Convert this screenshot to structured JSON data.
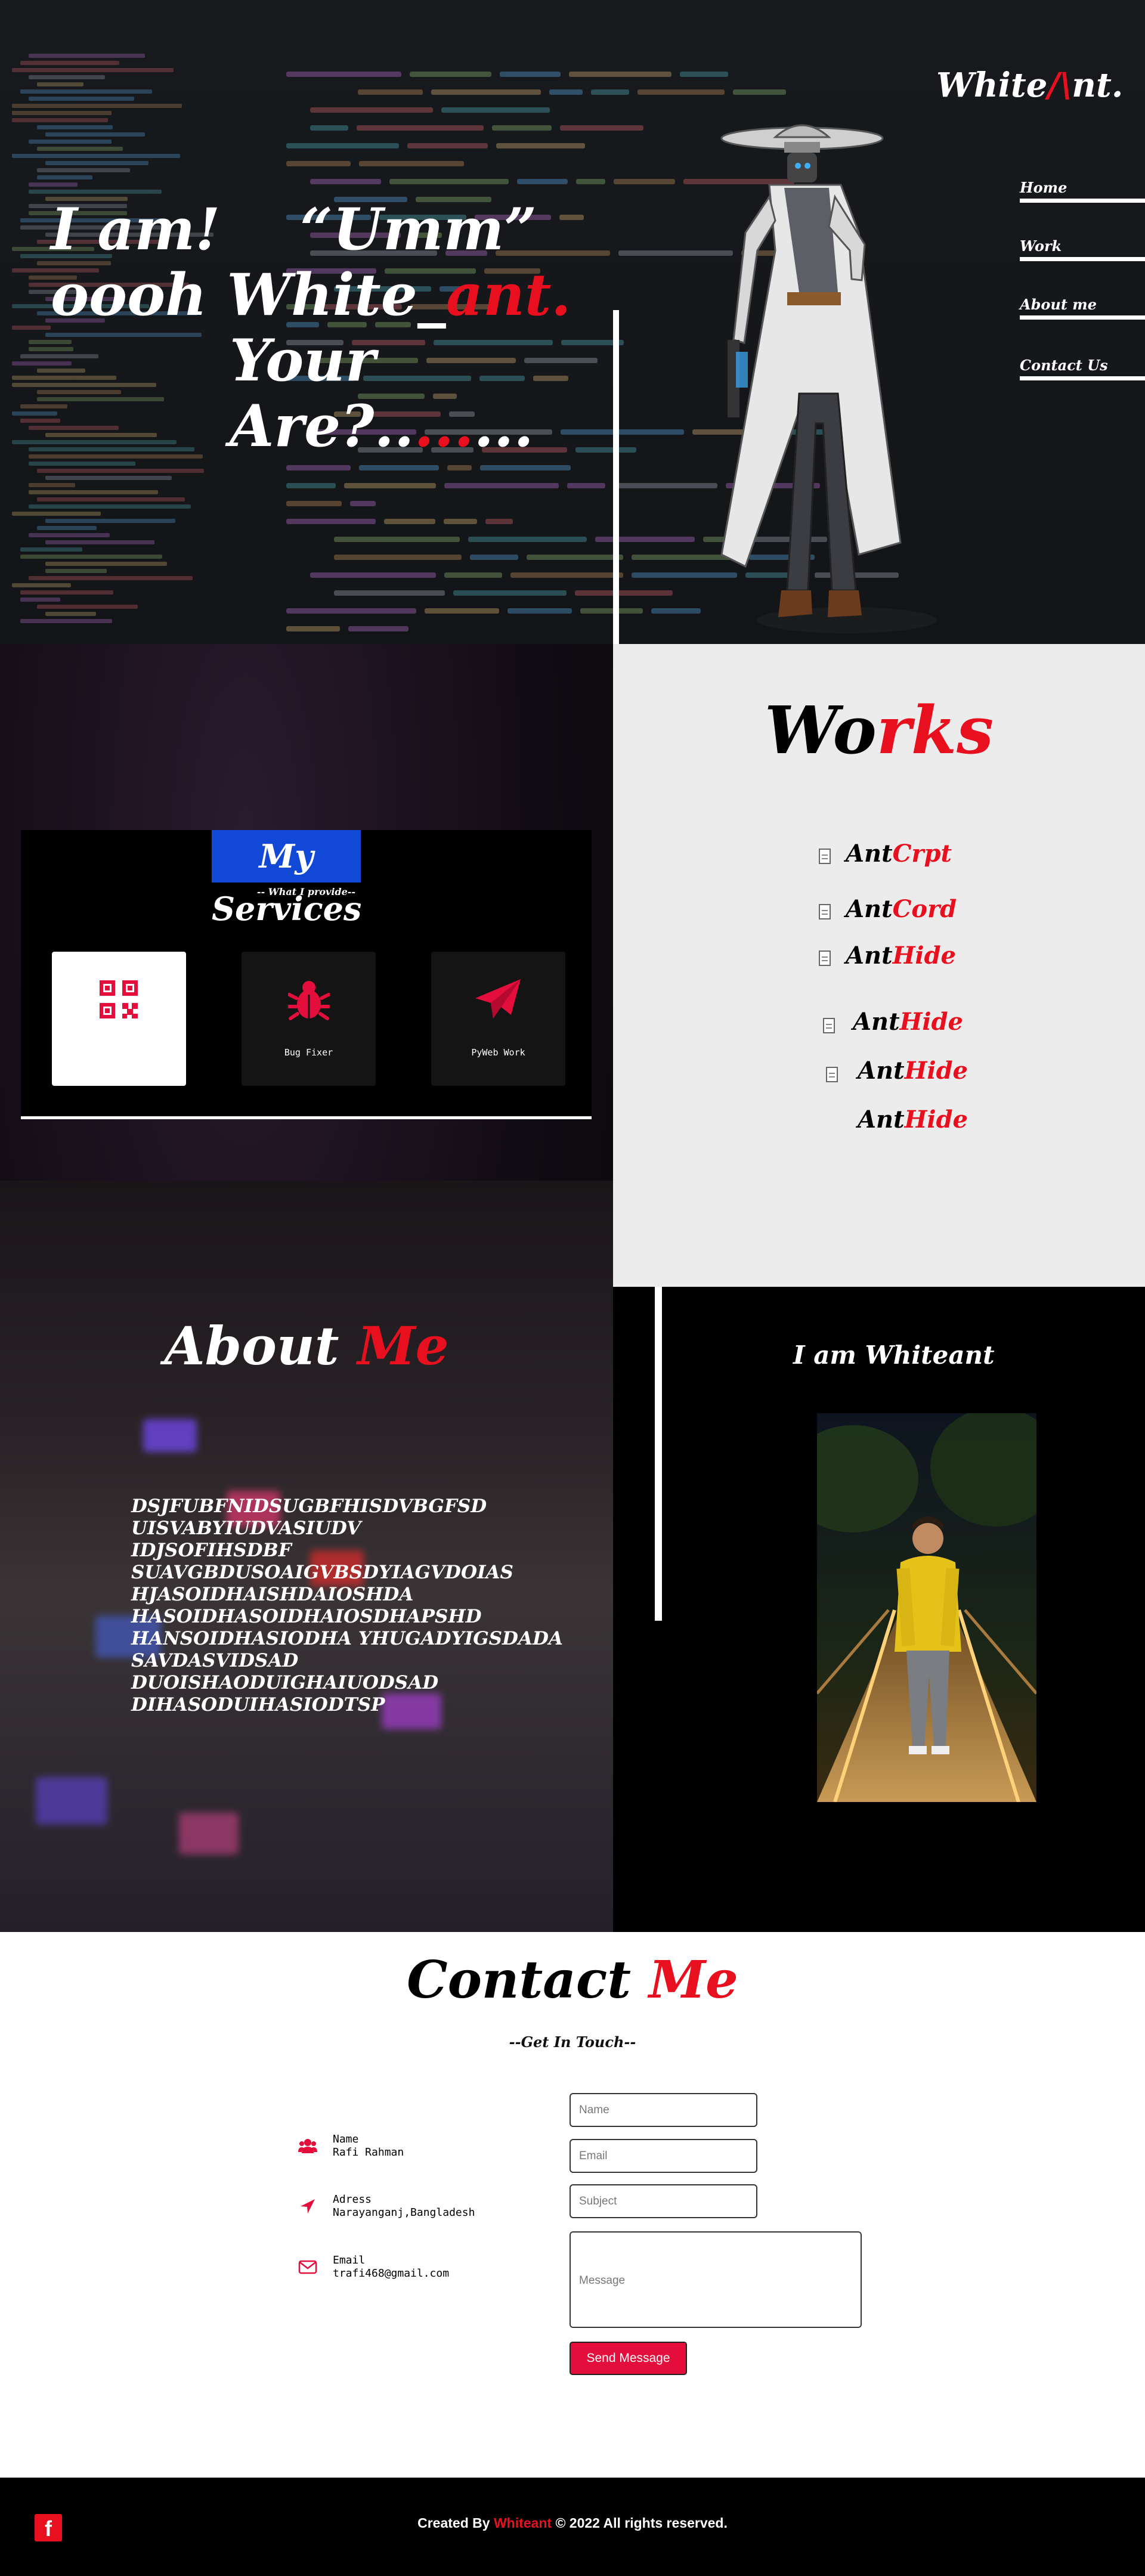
{
  "hero": {
    "line1": "I am!    “Umm”",
    "line2_pre": "oooh White_",
    "line2_red": "ant.",
    "line3_pre": "Your Are?..",
    "line3_red": "...",
    "line3_post": "..."
  },
  "brand": {
    "pre": "White",
    "red": "/\\",
    "post": "nt."
  },
  "nav": {
    "items": [
      "Home",
      "Work",
      "About me",
      "Contact Us"
    ]
  },
  "services": {
    "title": "My Services",
    "subtitle": "-- What I provide--",
    "items": [
      {
        "label": "",
        "icon": "qr-code-icon"
      },
      {
        "label": "Bug Fixer",
        "icon": "bug-icon"
      },
      {
        "label": "PyWeb Work",
        "icon": "paper-plane-icon"
      }
    ]
  },
  "works": {
    "title_pre": "Wo",
    "title_red": "rks",
    "items": [
      {
        "pre": "Ant",
        "red": "Crpt"
      },
      {
        "pre": "Ant",
        "red": "Cord"
      },
      {
        "pre": "Ant",
        "red": "Hide"
      },
      {
        "pre": "Ant",
        "red": "Hide"
      },
      {
        "pre": "Ant",
        "red": "Hide"
      },
      {
        "pre": "Ant",
        "red": "Hide"
      }
    ]
  },
  "about": {
    "title_pre": "About ",
    "title_red": "Me",
    "lines": [
      "DSJFUBFNIDSUGBFHISDVBGFSD",
      "UISVABYIUDVASIUDV",
      "IDJSOFIHSDBF",
      "SUAVGBDUSOAIGVBSDYIAGVDOIAS",
      "HJASOIDHAISHDAIOSHDA",
      "HASOIDHASOIDHAIOSDHAPSHD",
      "HANSOIDHASIODHA YHUGADYIGSDADA",
      "SAVDASVIDSAD",
      "DUOISHAODUIGHAIUODSAD",
      "DIHASODUIHASIODTSP"
    ]
  },
  "iam": {
    "title": "I am Whiteant"
  },
  "contact": {
    "title_pre": "Contact ",
    "title_red": "Me",
    "subtitle": "--Get In Touch--",
    "info": [
      {
        "label": "Name",
        "value": "Rafi Rahman",
        "icon": "users-icon"
      },
      {
        "label": "Adress",
        "value": "Narayanganj,Bangladesh",
        "icon": "location-arrow-icon"
      },
      {
        "label": "Email",
        "value": "trafi468@gmail.com",
        "icon": "envelope-icon"
      }
    ],
    "form": {
      "name_placeholder": "Name",
      "email_placeholder": "Email",
      "subject_placeholder": "Subject",
      "message_placeholder": "Message",
      "send_label": "Send Message"
    }
  },
  "footer": {
    "pre": "Created By ",
    "red": "Whiteant",
    "post": " © 2022 All rights reserved.",
    "social_icon": "facebook-icon"
  },
  "colors": {
    "accent": "#e8101e",
    "button": "#e40e3c",
    "services_title_bg": "#1248d6",
    "works_bg": "#ececec"
  }
}
